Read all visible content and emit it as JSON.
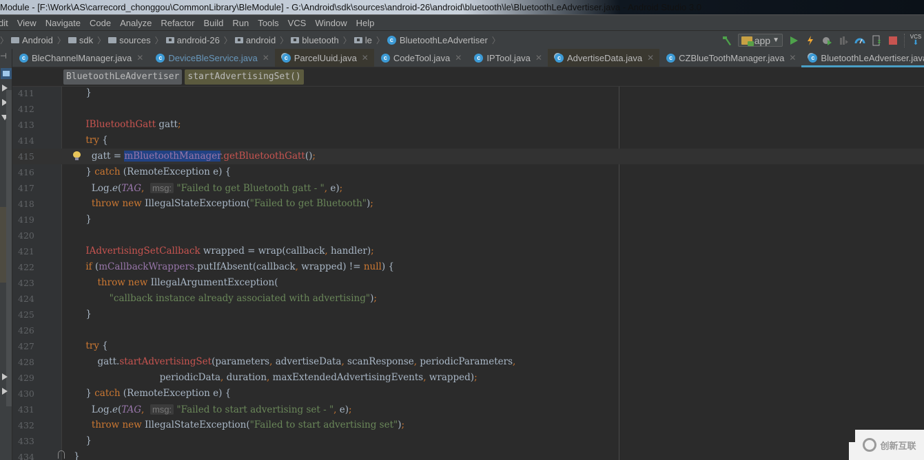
{
  "window": {
    "title": "Module - [F:\\Work\\AS\\carrecord_chonggou\\CommonLibrary\\BleModule] - G:\\Android\\sdk\\sources\\android-26\\android\\bluetooth\\le\\BluetoothLeAdvertiser.java - Android Studio 3.0"
  },
  "menu": [
    "dit",
    "View",
    "Navigate",
    "Code",
    "Analyze",
    "Refactor",
    "Build",
    "Run",
    "Tools",
    "VCS",
    "Window",
    "Help"
  ],
  "breadcrumb": [
    {
      "label": "Android",
      "icon": "folder-icon"
    },
    {
      "label": "sdk",
      "icon": "folder-icon"
    },
    {
      "label": "sources",
      "icon": "folder-icon"
    },
    {
      "label": "android-26",
      "icon": "package-icon"
    },
    {
      "label": "android",
      "icon": "package-icon"
    },
    {
      "label": "bluetooth",
      "icon": "package-icon"
    },
    {
      "label": "le",
      "icon": "package-icon"
    },
    {
      "label": "BluetoothLeAdvertiser",
      "icon": "class-icon"
    }
  ],
  "toolbar": {
    "run_config": "app",
    "buttons": [
      "build-hammer-icon",
      "run-icon",
      "apply-changes-icon",
      "debug-icon",
      "attach-debugger-icon",
      "profiler-icon",
      "sdk-manager-icon",
      "stop-icon",
      "vcs-update-icon"
    ],
    "vcs_label": "VCS"
  },
  "tabs": [
    {
      "label": "BleChannelManager.java",
      "active": false,
      "modified": false
    },
    {
      "label": "DeviceBleService.java",
      "active": false,
      "modified": true
    },
    {
      "label": "ParcelUuid.java",
      "active": false,
      "modified": false
    },
    {
      "label": "CodeTool.java",
      "active": false,
      "modified": false
    },
    {
      "label": "IPTool.java",
      "active": false,
      "modified": false
    },
    {
      "label": "AdvertiseData.java",
      "active": false,
      "modified": false
    },
    {
      "label": "CZBlueToothManager.java",
      "active": false,
      "modified": false
    },
    {
      "label": "BluetoothLeAdvertiser.java",
      "active": true,
      "modified": false
    }
  ],
  "structure": {
    "class": "BluetoothLeAdvertiser",
    "method": "startAdvertisingSet()"
  },
  "code": {
    "line_numbers": [
      "411",
      "412",
      "413",
      "414",
      "415",
      "416",
      "417",
      "418",
      "419",
      "420",
      "421",
      "422",
      "423",
      "424",
      "425",
      "426",
      "427",
      "428",
      "429",
      "430",
      "431",
      "432",
      "433",
      "434"
    ],
    "caret_line": "415",
    "selected_text": "mBluetoothManager"
  },
  "watermark": {
    "text": "创新互联"
  }
}
